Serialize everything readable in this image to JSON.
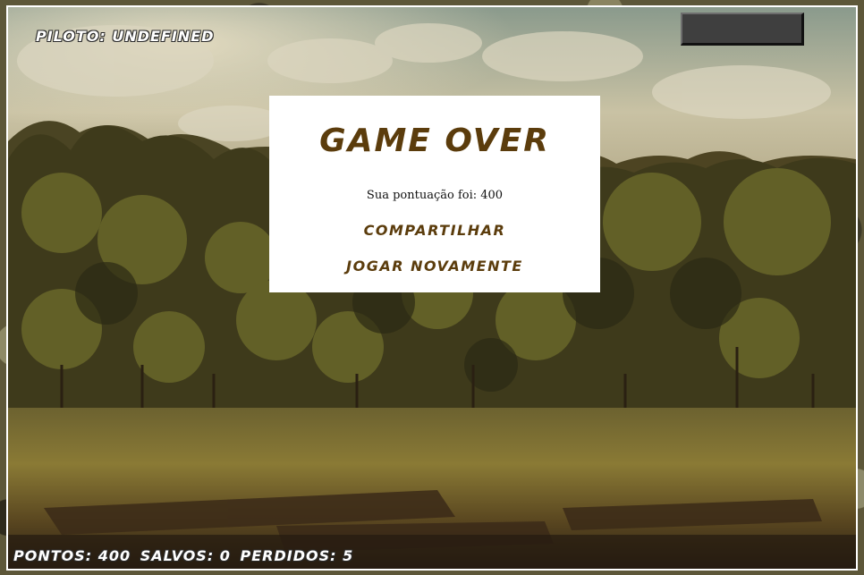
{
  "hud": {
    "pilot_label": "PILOTO: UNDEFINED",
    "points_label": "PONTOS: 400",
    "saved_label": "SALVOS: 0",
    "lost_label": "PERDIDOS: 5"
  },
  "dialog": {
    "title": "GAME OVER",
    "score_text": "Sua pontuação foi: 400",
    "share_label": "COMPARTILHAR",
    "replay_label": "JOGAR NOVAMENTE"
  },
  "colors": {
    "dialog_accent": "#5b3c0c",
    "hud_text": "#ffffff",
    "energy_box": "#3f3f3f"
  }
}
